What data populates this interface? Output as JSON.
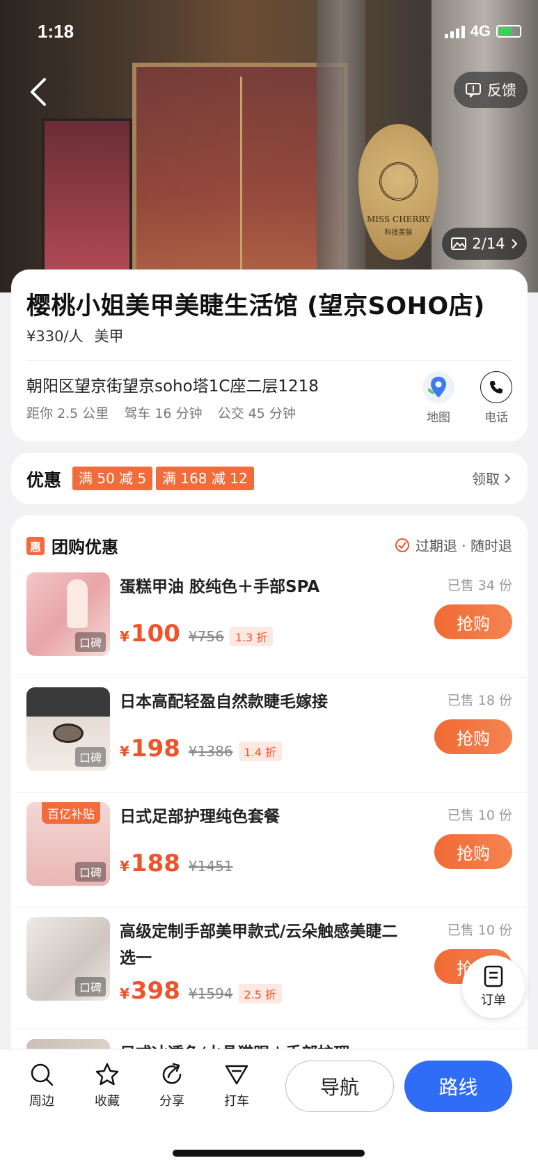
{
  "status_bar": {
    "time": "1:18",
    "network": "4G"
  },
  "hero": {
    "feedback_label": "反馈",
    "photo_counter": "2/14",
    "plaque_text": "MISS CHERRY",
    "plaque_subtext": "科技美肤"
  },
  "shop": {
    "name": "樱桃小姐美甲美睫生活馆 (望京SOHO店)",
    "price_per_person": "¥330/人",
    "category": "美甲",
    "address": "朝阳区望京街望京soho塔1C座二层1218",
    "distance": "距你 2.5 公里",
    "drive": "驾车 16 分钟",
    "bus": "公交 45 分钟",
    "map_label": "地图",
    "phone_label": "电话"
  },
  "coupons": {
    "label": "优惠",
    "tags": [
      "满 50 减 5",
      "满 168 减 12"
    ],
    "get_label": "领取"
  },
  "group_buy": {
    "title": "团购优惠",
    "hui_icon_text": "惠",
    "refund_text": "过期退 · 随时退",
    "thumb_label": "口碑",
    "buy_label": "抢购",
    "items": [
      {
        "name": "蛋糕甲油 胶纯色＋手部SPA",
        "currency": "¥",
        "price": "100",
        "original": "¥756",
        "discount": "1.3 折",
        "sold": "已售 34 份"
      },
      {
        "name": "日本高配轻盈自然款睫毛嫁接",
        "currency": "¥",
        "price": "198",
        "original": "¥1386",
        "discount": "1.4 折",
        "sold": "已售 18 份"
      },
      {
        "name": "日式足部护理纯色套餐",
        "currency": "¥",
        "price": "188",
        "original": "¥1451",
        "discount": "",
        "sold": "已售 10 份",
        "badge": "百亿补贴"
      },
      {
        "name": "高级定制手部美甲款式/云朵触感美睫二选一",
        "currency": "¥",
        "price": "398",
        "original": "¥1594",
        "discount": "2.5 折",
        "sold": "已售 10 份"
      },
      {
        "name": "日式冰透色/水晶猫眼＋手部护理"
      }
    ]
  },
  "order_float_label": "订单",
  "bottom_bar": {
    "nearby": "周边",
    "favorite": "收藏",
    "share": "分享",
    "taxi": "打车",
    "navigate": "导航",
    "route": "路线"
  }
}
